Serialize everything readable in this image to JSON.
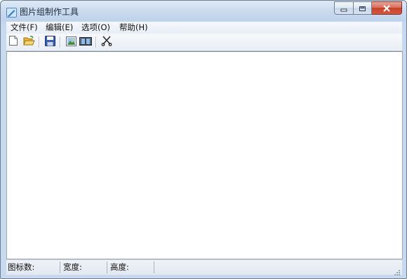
{
  "window": {
    "title": "图片组制作工具",
    "icon": "pen-picture-icon"
  },
  "caption_buttons": [
    {
      "name": "minimize-button",
      "icon": "minimize-icon"
    },
    {
      "name": "maximize-button",
      "icon": "maximize-icon"
    },
    {
      "name": "close-button",
      "icon": "close-icon"
    }
  ],
  "menu": {
    "file": "文件(F)",
    "edit": "编辑(E)",
    "options": "选项(O)",
    "help": "帮助(H)"
  },
  "toolbar": [
    {
      "icon": "new-file-icon"
    },
    {
      "icon": "open-folder-icon"
    },
    {
      "icon": "save-disk-icon"
    },
    {
      "icon": "picture-icon"
    },
    {
      "icon": "filmstrip-icon"
    },
    {
      "icon": "cut-scissors-icon"
    }
  ],
  "status": {
    "icon_count_label": "图标数:",
    "width_label": "宽度:",
    "height_label": "高度:"
  },
  "colors": {
    "titlebar": "#c8daef",
    "close_button": "#c7402b",
    "client_background": "#ffffff"
  }
}
